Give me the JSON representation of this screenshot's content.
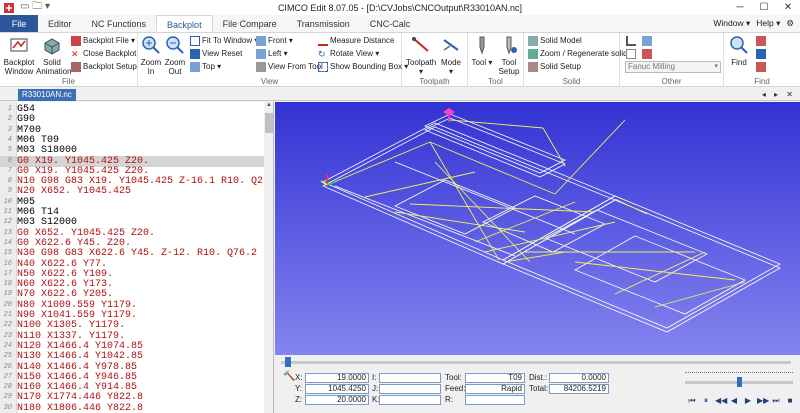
{
  "window": {
    "title": "CIMCO Edit 8.07.05 - [D:\\CVJobs\\CNCOutput\\R33010AN.nc]",
    "minimize": "─",
    "maximize": "☐",
    "close": "✕"
  },
  "tabs": [
    {
      "label": "File"
    },
    {
      "label": "Editor"
    },
    {
      "label": "NC Functions"
    },
    {
      "label": "Backplot"
    },
    {
      "label": "File Compare"
    },
    {
      "label": "Transmission"
    },
    {
      "label": "CNC-Calc"
    }
  ],
  "tabs_right": {
    "window": "Window ▾",
    "help": "Help ▾"
  },
  "ribbon": {
    "file": {
      "backplot_window": "Backplot Window",
      "solid_animation": "Solid Animation",
      "backplot_file": "Backplot File ▾",
      "close_backplot": "Close Backplot",
      "backplot_setup": "Backplot Setup",
      "label": "File"
    },
    "view": {
      "zoom_in": "Zoom In",
      "zoom_out": "Zoom Out",
      "fit_to_window": "Fit To Window ▾",
      "view_reset": "View Reset",
      "top": "Top ▾",
      "front": "Front ▾",
      "left": "Left ▾",
      "view_from_tool": "View From Tool",
      "measure_distance": "Measure Distance",
      "rotate_view": "Rotate View ▾",
      "show_bounding_box": "Show Bounding Box ▾",
      "label": "View"
    },
    "toolpath": {
      "toolpath": "Toolpath ▾",
      "mode": "Mode ▾",
      "label": "Toolpath"
    },
    "tool": {
      "tool": "Tool ▾",
      "tool_setup": "Tool Setup",
      "label": "Tool"
    },
    "solid": {
      "solid_model": "Solid Model",
      "zoom_regenerate": "Zoom / Regenerate solid",
      "solid_setup": "Solid Setup",
      "label": "Solid"
    },
    "other": {
      "machine_combo": "Fanuc Milling",
      "label": "Other"
    },
    "find": {
      "find": "Find",
      "label": "Find"
    }
  },
  "document": {
    "tab": "R33010AN.nc",
    "controls": "◂ ▸ ✕"
  },
  "editor": {
    "lines": [
      {
        "n": "1",
        "code": "G54",
        "c": "blk"
      },
      {
        "n": "2",
        "code": "G90",
        "c": "blk"
      },
      {
        "n": "3",
        "code": "M700",
        "c": "blk"
      },
      {
        "n": "4",
        "code": "M06 T09",
        "c": "blk"
      },
      {
        "n": "5",
        "code": "M03 S18000",
        "c": "blk"
      },
      {
        "n": "6",
        "code": "G0 X19. Y1045.425 Z20.",
        "c": "red"
      },
      {
        "n": "7",
        "code": "G0 X19. Y1045.425 Z20.",
        "c": "red"
      },
      {
        "n": "8",
        "code": "N10 G98 G83 X19. Y1045.425 Z-16.1 R10. Q2",
        "c": "red"
      },
      {
        "n": "9",
        "code": "N20 X652. Y1045.425",
        "c": "red"
      },
      {
        "n": "10",
        "code": "M05",
        "c": "blk"
      },
      {
        "n": "11",
        "code": "M06 T14",
        "c": "blk"
      },
      {
        "n": "12",
        "code": "M03 S12000",
        "c": "blk"
      },
      {
        "n": "13",
        "code": "G0 X652. Y1045.425 Z20.",
        "c": "red"
      },
      {
        "n": "14",
        "code": "G0 X622.6 Y45. Z20.",
        "c": "red"
      },
      {
        "n": "15",
        "code": "N30 G98 G83 X622.6 Y45. Z-12. R10. Q76.2 I",
        "c": "red"
      },
      {
        "n": "16",
        "code": "N40 X622.6 Y77.",
        "c": "red"
      },
      {
        "n": "17",
        "code": "N50 X622.6 Y109.",
        "c": "red"
      },
      {
        "n": "18",
        "code": "N60 X622.6 Y173.",
        "c": "red"
      },
      {
        "n": "19",
        "code": "N70 X622.6 Y205.",
        "c": "red"
      },
      {
        "n": "20",
        "code": "N80 X1009.559 Y1179.",
        "c": "red"
      },
      {
        "n": "21",
        "code": "N90 X1041.559 Y1179.",
        "c": "red"
      },
      {
        "n": "22",
        "code": "N100 X1305. Y1179.",
        "c": "red"
      },
      {
        "n": "23",
        "code": "N110 X1337. Y1179.",
        "c": "red"
      },
      {
        "n": "24",
        "code": "N120 X1466.4 Y1074.85",
        "c": "red"
      },
      {
        "n": "25",
        "code": "N130 X1466.4 Y1042.85",
        "c": "red"
      },
      {
        "n": "26",
        "code": "N140 X1466.4 Y978.85",
        "c": "red"
      },
      {
        "n": "27",
        "code": "N150 X1466.4 Y946.85",
        "c": "red"
      },
      {
        "n": "28",
        "code": "N160 X1466.4 Y914.85",
        "c": "red"
      },
      {
        "n": "29",
        "code": "N170 X1774.446 Y822.8",
        "c": "red"
      },
      {
        "n": "30",
        "code": "N180 X1806.446 Y822.8",
        "c": "red"
      }
    ]
  },
  "position": {
    "x_label": "X:",
    "x": "19.0000",
    "y_label": "Y:",
    "y": "1045.4250",
    "z_label": "Z:",
    "z": "20.0000",
    "i_label": "I:",
    "j_label": "J:",
    "k_label": "K:",
    "tool_label": "Tool:",
    "tool": "T09",
    "feed_label": "Feed:",
    "feed": "Rapid",
    "r_label": "R:",
    "dist_label": "Dist.:",
    "dist": "0.0000",
    "total_label": "Total:",
    "total": "84206.5219"
  },
  "playback": [
    "⏮",
    "⏸",
    "◀◀",
    "◀",
    "▶",
    "▶▶",
    "⏭",
    "■"
  ],
  "colors": {
    "file_tab": "#2b579a",
    "view_bg": "#4a4ad8",
    "toolpath": "#e8e860",
    "highlight": "#d4d4d4"
  }
}
